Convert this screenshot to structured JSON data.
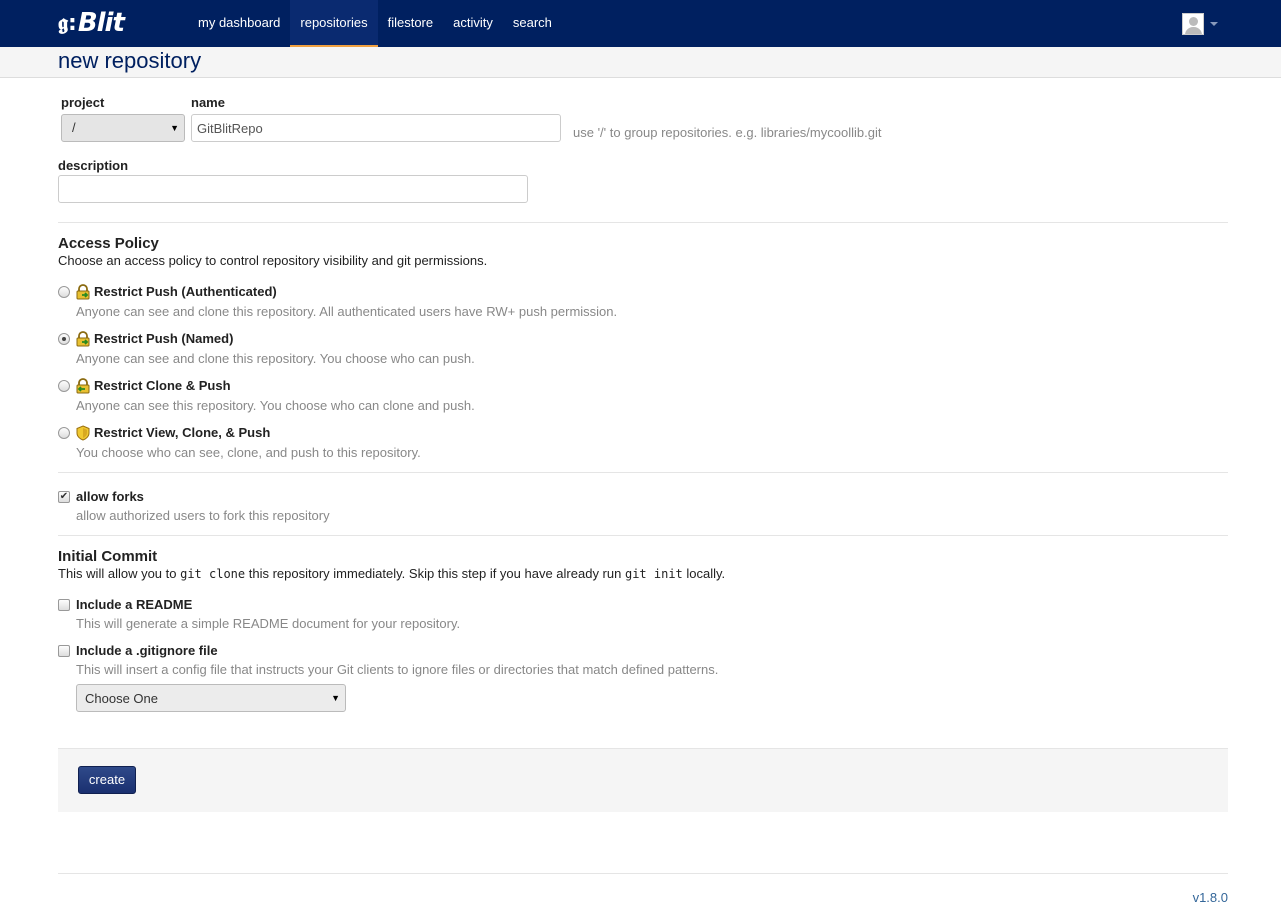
{
  "app": {
    "logo_mark": "𝖌:",
    "logo_text": "Blit"
  },
  "nav": {
    "items": [
      {
        "label": "my dashboard",
        "active": false
      },
      {
        "label": "repositories",
        "active": true
      },
      {
        "label": "filestore",
        "active": false
      },
      {
        "label": "activity",
        "active": false
      },
      {
        "label": "search",
        "active": false
      }
    ]
  },
  "page": {
    "title": "new repository"
  },
  "form": {
    "project_label": "project",
    "project_value": "/",
    "name_label": "name",
    "name_value": "GitBlitRepo",
    "name_help": "use '/' to group repositories. e.g. libraries/mycoollib.git",
    "description_label": "description",
    "description_value": ""
  },
  "access_policy": {
    "title": "Access Policy",
    "description": "Choose an access policy to control repository visibility and git permissions.",
    "options": [
      {
        "label": "Restrict Push (Authenticated)",
        "description": "Anyone can see and clone this repository. All authenticated users have RW+ push permission.",
        "icon": "lock-push-icon",
        "checked": false
      },
      {
        "label": "Restrict Push (Named)",
        "description": "Anyone can see and clone this repository. You choose who can push.",
        "icon": "lock-push-icon",
        "checked": true
      },
      {
        "label": "Restrict Clone & Push",
        "description": "Anyone can see this repository. You choose who can clone and push.",
        "icon": "lock-pull-icon",
        "checked": false
      },
      {
        "label": "Restrict View, Clone, & Push",
        "description": "You choose who can see, clone, and push to this repository.",
        "icon": "shield-icon",
        "checked": false
      }
    ]
  },
  "forks": {
    "label": "allow forks",
    "description": "allow authorized users to fork this repository",
    "checked": true
  },
  "initial_commit": {
    "title": "Initial Commit",
    "desc_part1": "This will allow you to ",
    "code1": "git clone",
    "desc_part2": " this repository immediately. Skip this step if you have already run ",
    "code2": "git init",
    "desc_part3": " locally.",
    "readme_label": "Include a README",
    "readme_desc": "This will generate a simple README document for your repository.",
    "readme_checked": false,
    "gitignore_label": "Include a .gitignore file",
    "gitignore_desc": "This will insert a config file that instructs your Git clients to ignore files or directories that match defined patterns.",
    "gitignore_checked": false,
    "gitignore_select": "Choose One"
  },
  "actions": {
    "create_label": "create"
  },
  "footer": {
    "version": "v1.8.0"
  },
  "colors": {
    "topbar": "#002060",
    "active_tab_underline": "#f0a040",
    "create_button": "#1a3070"
  }
}
